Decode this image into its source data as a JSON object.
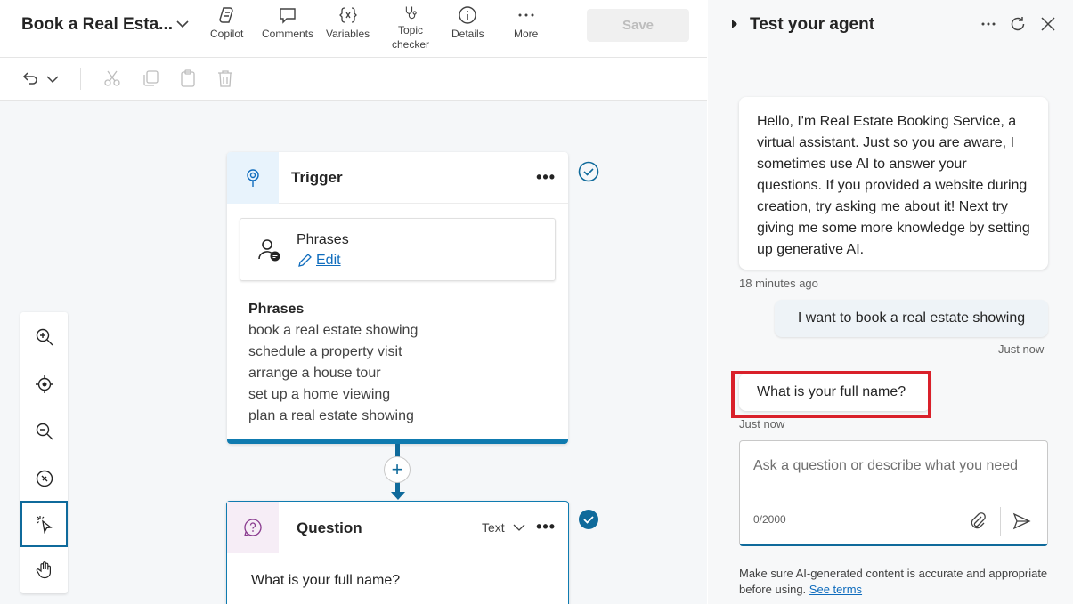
{
  "header": {
    "topic_title": "Book a Real Esta...",
    "toolbar": [
      {
        "label": "Copilot",
        "icon": "copilot-icon"
      },
      {
        "label": "Comments",
        "icon": "comment-icon"
      },
      {
        "label": "Variables",
        "icon": "variables-icon"
      },
      {
        "label": "Topic\nchecker",
        "icon": "stethoscope-icon"
      },
      {
        "label": "Details",
        "icon": "info-icon"
      },
      {
        "label": "More",
        "icon": "more-icon"
      }
    ],
    "save_label": "Save"
  },
  "trigger_node": {
    "title": "Trigger",
    "card_title": "Phrases",
    "edit_label": "Edit",
    "list_title": "Phrases",
    "phrases": [
      "book a real estate showing",
      "schedule a property visit",
      "arrange a house tour",
      "set up a home viewing",
      "plan a real estate showing"
    ]
  },
  "question_node": {
    "title": "Question",
    "type_label": "Text",
    "text": "What is your full name?"
  },
  "test_pane": {
    "title": "Test your agent",
    "messages": [
      {
        "role": "bot",
        "text": "Hello, I'm Real Estate Booking Service, a virtual assistant. Just so you are aware, I sometimes use AI to answer your questions. If you provided a website during creation, try asking me about it! Next try giving me some more knowledge by setting up generative AI.",
        "time": "18 minutes ago"
      },
      {
        "role": "user",
        "text": "I want to book a real estate showing",
        "time": "Just now"
      },
      {
        "role": "bot",
        "text": "What is your full name?",
        "time": "Just now"
      }
    ],
    "input_placeholder": "Ask a question or describe what you need",
    "counter": "0/2000",
    "disclaimer": "Make sure AI-generated content is accurate and appropriate before using.",
    "see_terms": "See terms"
  },
  "colors": {
    "accent": "#0f6a9b",
    "highlight": "#d9202a",
    "link": "#0f6cbd"
  }
}
